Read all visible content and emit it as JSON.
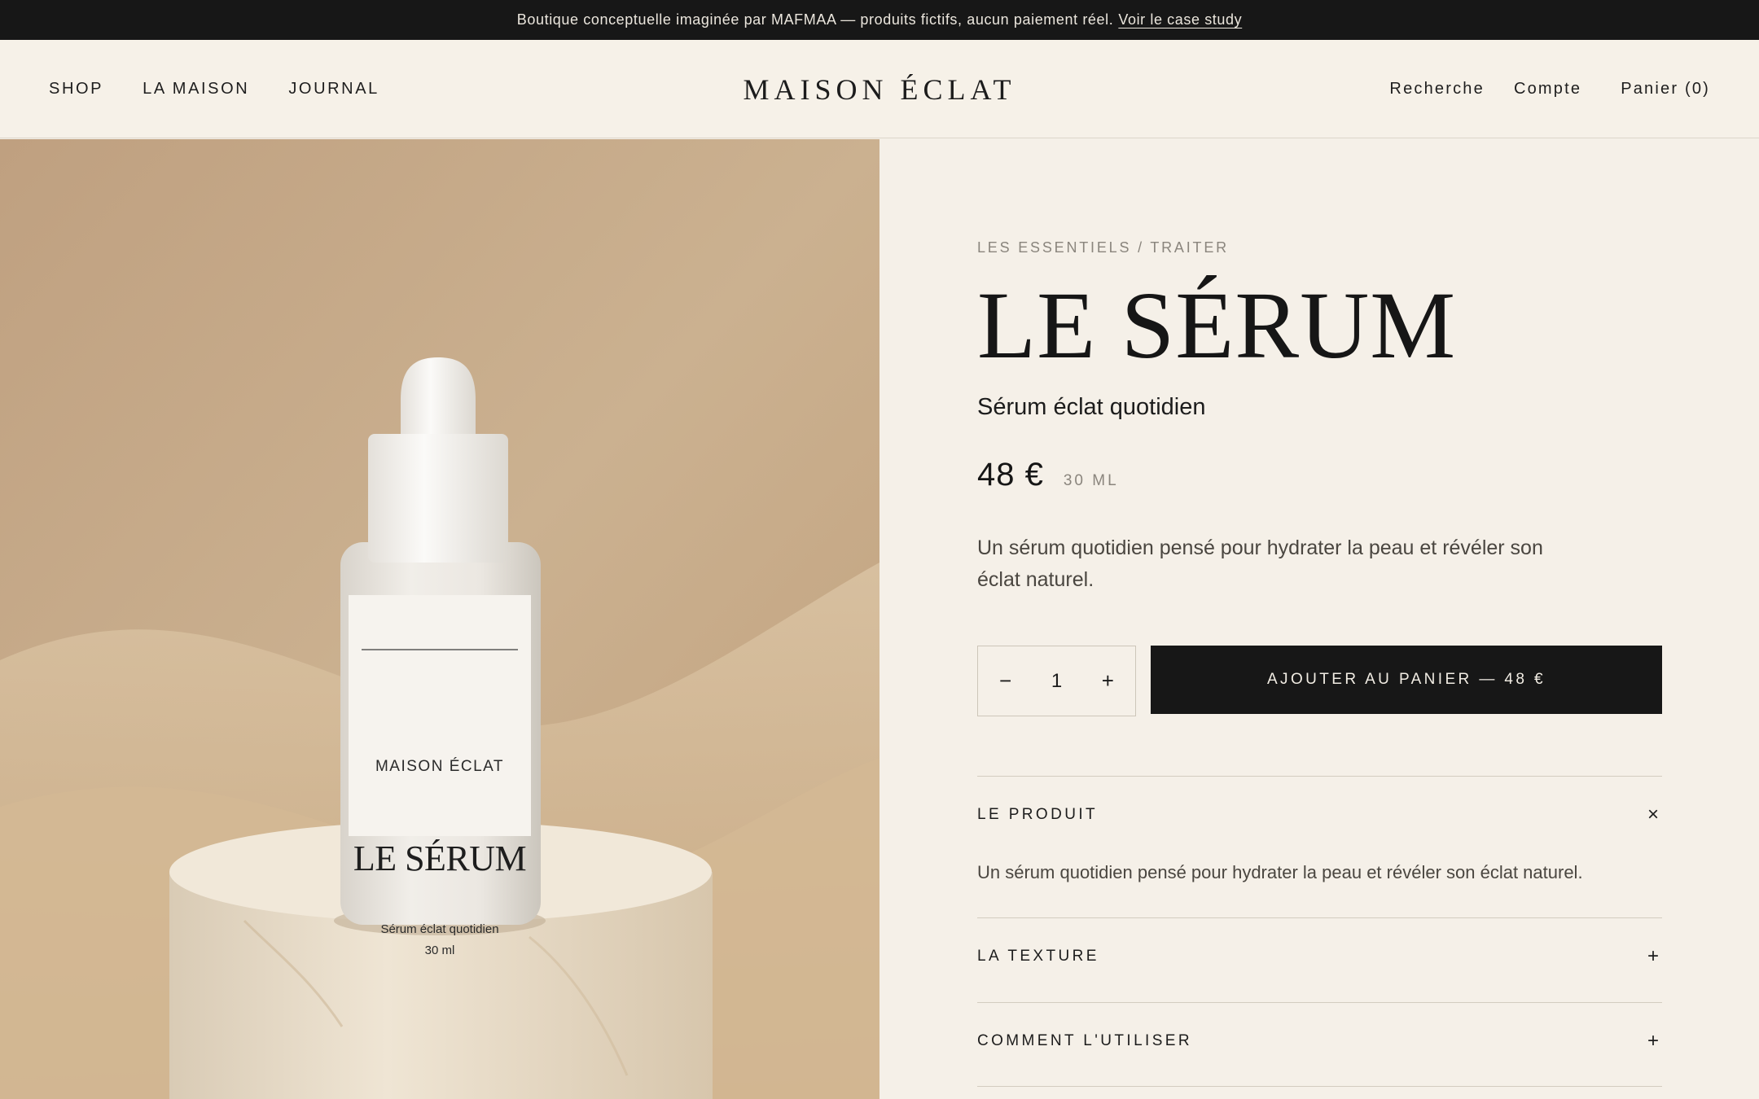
{
  "announcement": {
    "text": "Boutique conceptuelle imaginée par MAFMAA — produits fictifs, aucun paiement réel.",
    "link": "Voir le case study"
  },
  "header": {
    "nav_left": [
      "SHOP",
      "LA MAISON",
      "JOURNAL"
    ],
    "logo": "MAISON ÉCLAT",
    "search": "Recherche",
    "account": "Compte",
    "cart": "Panier (0)"
  },
  "product_image": {
    "label_brand": "MAISON ÉCLAT",
    "label_name": "LE SÉRUM",
    "label_desc": "Sérum éclat quotidien",
    "label_volume": "30 ml"
  },
  "product": {
    "breadcrumb": "LES ESSENTIELS / TRAITER",
    "title": "LE SÉRUM",
    "subtitle": "Sérum éclat quotidien",
    "price": "48 €",
    "volume": "30 ML",
    "description": "Un sérum quotidien pensé pour hydrater la peau et révéler son éclat naturel.",
    "quantity": "1",
    "minus": "−",
    "plus": "+",
    "add_to_cart": "AJOUTER AU PANIER — 48 €"
  },
  "accordion": [
    {
      "label": "LE PRODUIT",
      "symbol": "×",
      "expanded": true,
      "content": "Un sérum quotidien pensé pour hydrater la peau et révéler son éclat naturel."
    },
    {
      "label": "LA TEXTURE",
      "symbol": "+",
      "expanded": false
    },
    {
      "label": "COMMENT L'UTILISER",
      "symbol": "+",
      "expanded": false
    }
  ],
  "colors": {
    "background": "#f5f0e8",
    "dark": "#171717",
    "muted": "#8a857d",
    "sand": "#c8ad8a"
  }
}
